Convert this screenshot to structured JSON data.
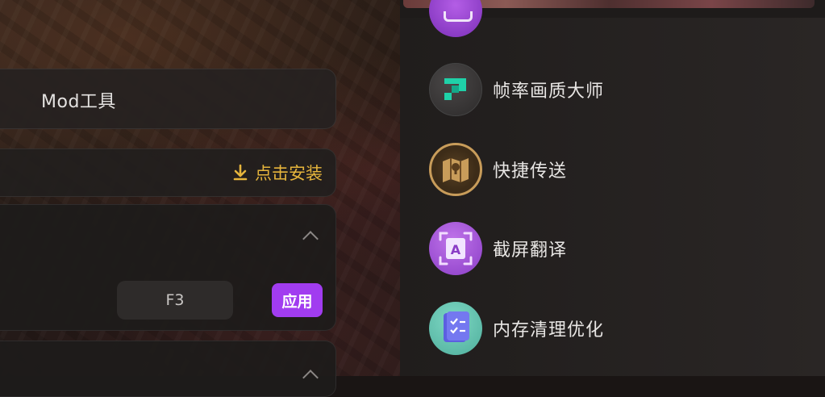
{
  "left": {
    "mod_card": {
      "title": "Mod工具"
    },
    "install_card": {
      "install_label": "点击安装",
      "install_color": "#e6b53c"
    },
    "hotkey_card": {
      "hotkey_value": "F3",
      "apply_label": "应用",
      "apply_color": "#a13cf0"
    }
  },
  "right": {
    "tools": [
      {
        "label": "帧率画质大师",
        "icon": "pixel-arrow-icon"
      },
      {
        "label": "快捷传送",
        "icon": "map-icon"
      },
      {
        "label": "截屏翻译",
        "icon": "translate-icon"
      },
      {
        "label": "内存清理优化",
        "icon": "checklist-icon"
      }
    ]
  }
}
